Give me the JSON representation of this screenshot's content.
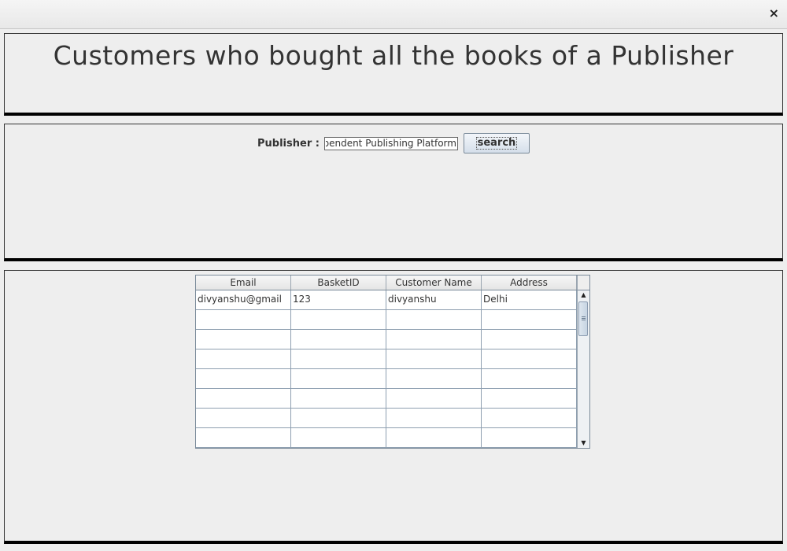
{
  "window": {
    "close_glyph": "×"
  },
  "title": "Customers who bought all the books of a Publisher",
  "search": {
    "label": "Publisher :",
    "value": "Independent Publishing Platform",
    "button_label": "search"
  },
  "table": {
    "columns": [
      "Email",
      "BasketID",
      "Customer Name",
      "Address"
    ],
    "rows": [
      [
        "divyanshu@gmail",
        "123",
        "divyanshu",
        "Delhi"
      ],
      [
        "",
        "",
        "",
        ""
      ],
      [
        "",
        "",
        "",
        ""
      ],
      [
        "",
        "",
        "",
        ""
      ],
      [
        "",
        "",
        "",
        ""
      ],
      [
        "",
        "",
        "",
        ""
      ],
      [
        "",
        "",
        "",
        ""
      ],
      [
        "",
        "",
        "",
        ""
      ]
    ]
  }
}
